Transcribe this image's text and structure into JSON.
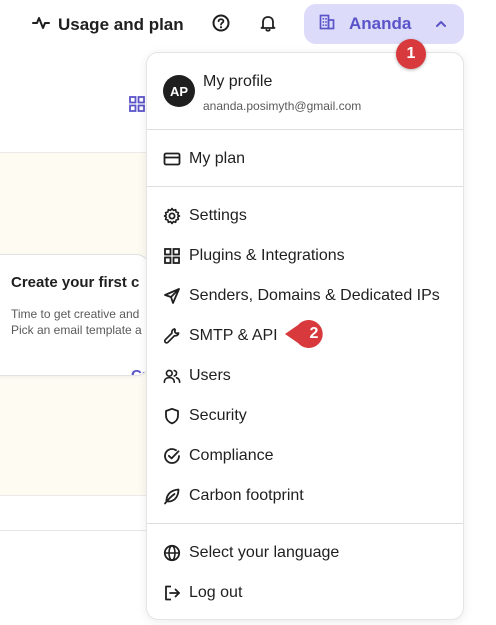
{
  "header": {
    "usage_label": "Usage and plan",
    "account_name": "Ananda"
  },
  "background": {
    "card_title": "Create your first c",
    "card_line1": "Time to get creative and",
    "card_line2": "Pick an email template a",
    "card_cta": "Cr"
  },
  "menu": {
    "profile": {
      "initials": "AP",
      "title": "My profile",
      "email": "ananda.posimyth@gmail.com"
    },
    "my_plan": "My plan",
    "items": [
      {
        "label": "Settings",
        "icon": "gear-icon"
      },
      {
        "label": "Plugins & Integrations",
        "icon": "grid-icon"
      },
      {
        "label": "Senders, Domains & Dedicated IPs",
        "icon": "send-icon"
      },
      {
        "label": "SMTP & API",
        "icon": "wrench-icon"
      },
      {
        "label": "Users",
        "icon": "users-icon"
      },
      {
        "label": "Security",
        "icon": "shield-icon"
      },
      {
        "label": "Compliance",
        "icon": "check-circle-icon"
      },
      {
        "label": "Carbon footprint",
        "icon": "leaf-icon"
      }
    ],
    "language": "Select your language",
    "logout": "Log out"
  },
  "annotations": {
    "step1": "1",
    "step2": "2",
    "badge_color": "#d8393c"
  },
  "colors": {
    "accent": "#5b54c9",
    "account_bg": "#dcdcfa"
  }
}
